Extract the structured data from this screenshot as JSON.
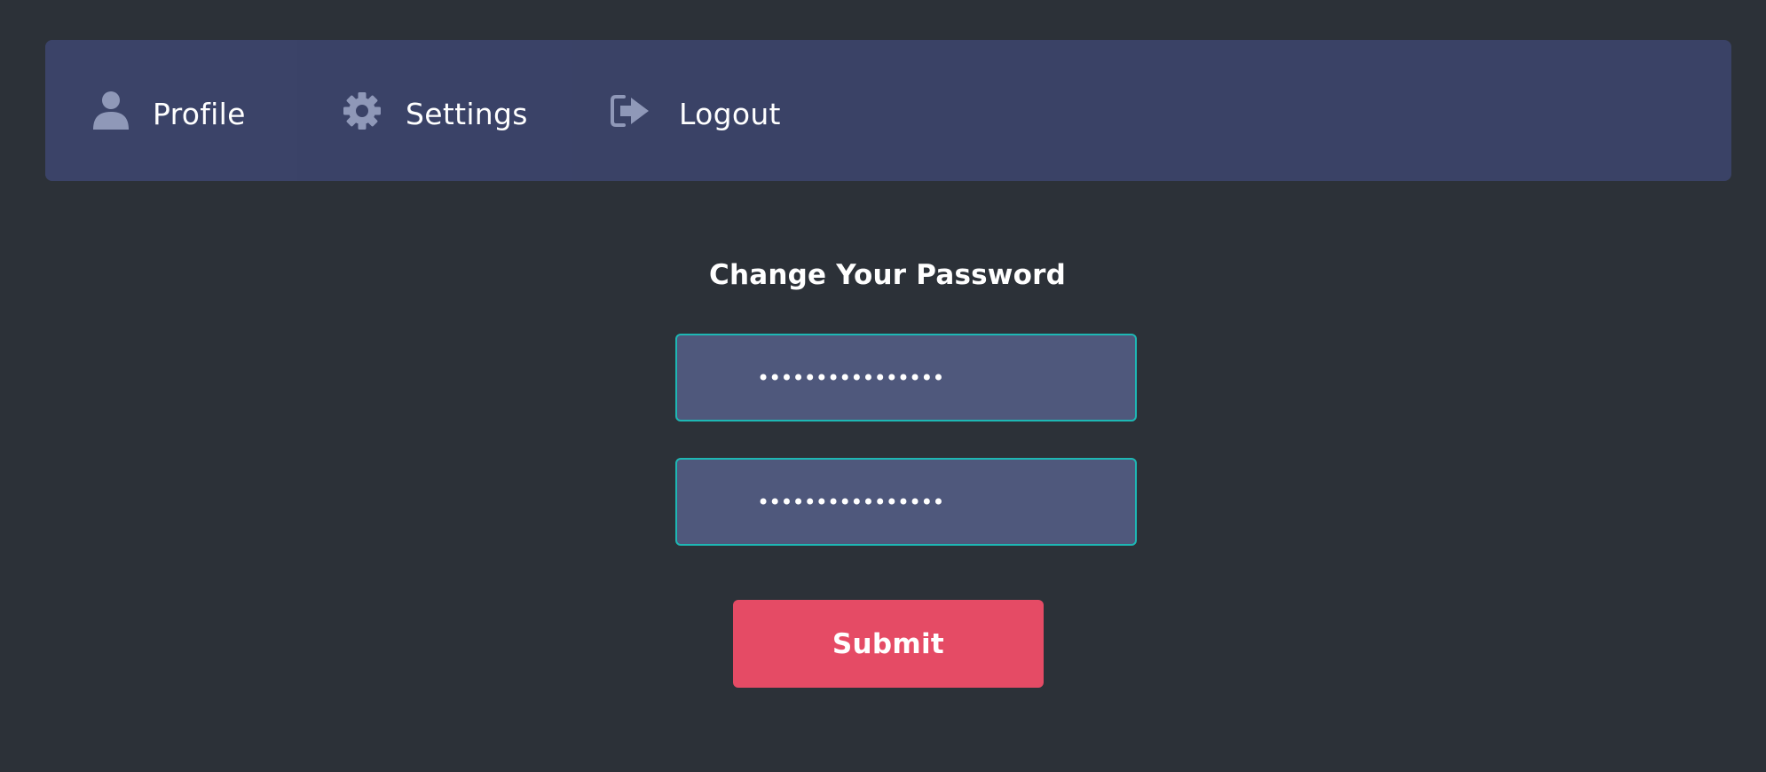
{
  "nav": {
    "items": [
      {
        "label": "Profile",
        "icon": "user-icon"
      },
      {
        "label": "Settings",
        "icon": "gear-icon"
      },
      {
        "label": "Logout",
        "icon": "sign-out-icon"
      }
    ]
  },
  "form": {
    "title": "Change Your Password",
    "new_password_value": "••••••••••••••••",
    "confirm_password_value": "••••••••••••••••",
    "submit_label": "Submit"
  },
  "colors": {
    "background": "#2c3138",
    "navbar": "#3a4266",
    "icon": "#8f98b8",
    "input_bg": "#4f587c",
    "input_border": "#1eb7b4",
    "submit": "#e54b65"
  }
}
